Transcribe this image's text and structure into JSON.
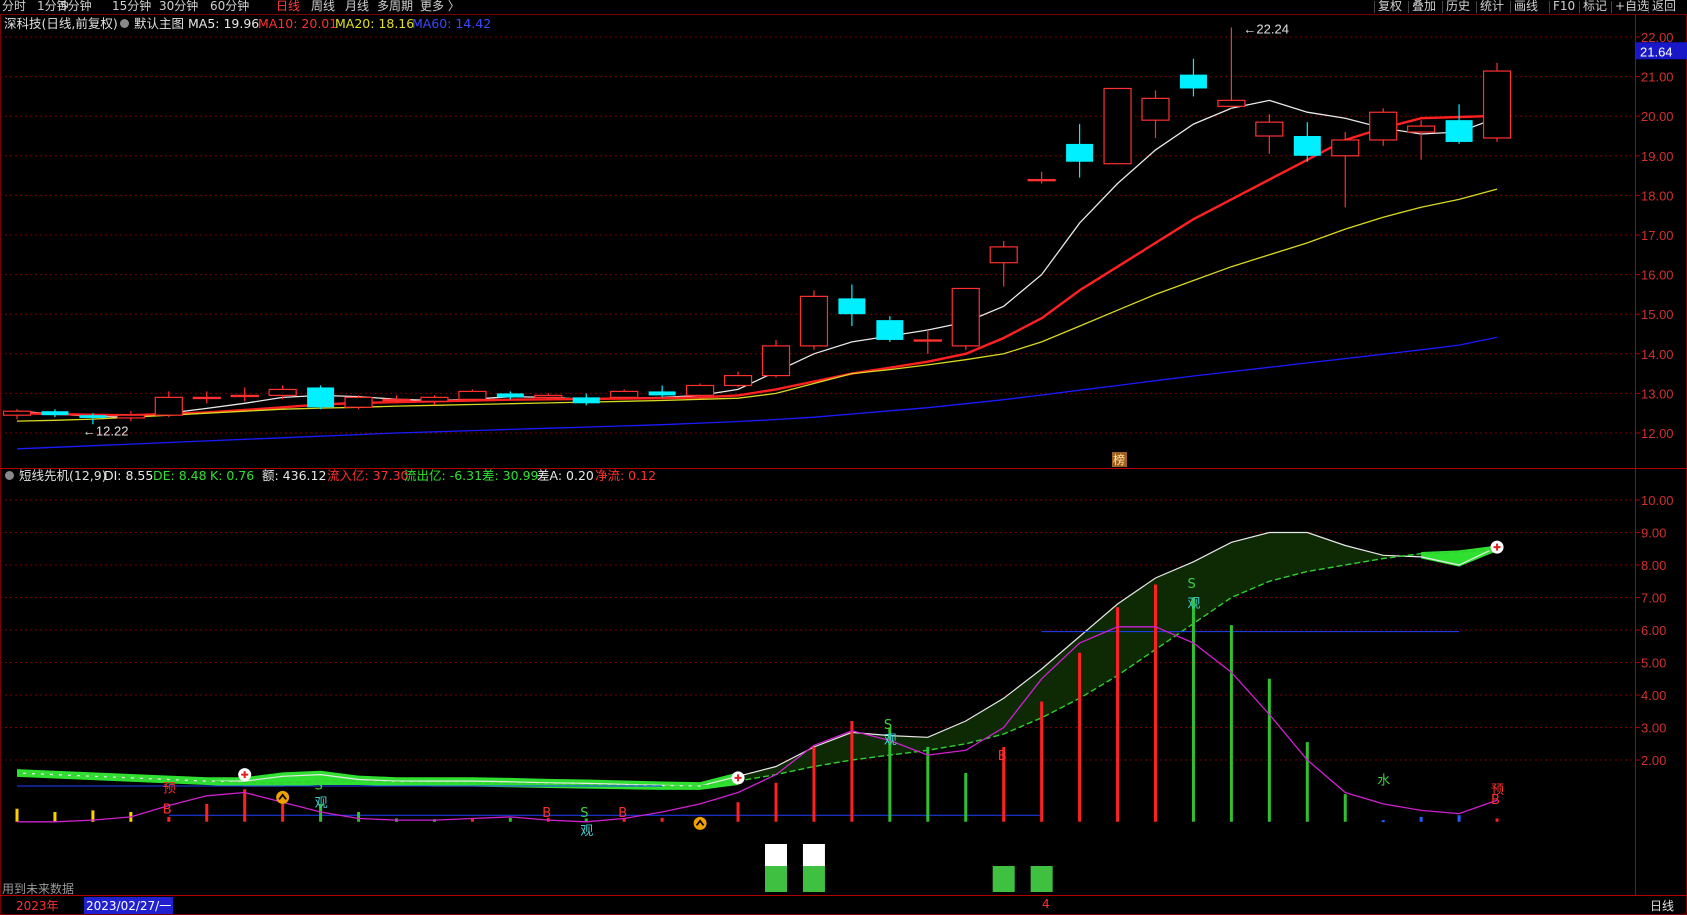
{
  "toolbar": {
    "periods": [
      {
        "label": "分时",
        "active": false
      },
      {
        "label": "1分钟",
        "active": false
      },
      {
        "label": "5分钟",
        "active": false
      },
      {
        "label": "15分钟",
        "active": false
      },
      {
        "label": "30分钟",
        "active": false
      },
      {
        "label": "60分钟",
        "active": false
      },
      {
        "label": "日线",
        "active": true
      },
      {
        "label": "周线",
        "active": false
      },
      {
        "label": "月线",
        "active": false
      },
      {
        "label": "多周期",
        "active": false
      },
      {
        "label": "更多 〉",
        "active": false
      }
    ],
    "right_buttons": [
      "复权",
      "叠加",
      "历史",
      "统计",
      "画线",
      "F10",
      "标记",
      "+自选",
      "返回"
    ]
  },
  "main_header": {
    "title": "深科技(日线,前复权)",
    "template": "默认主图",
    "ma5": "MA5: 19.96",
    "ma10": "MA10: 20.01",
    "ma20": "MA20: 18.16",
    "ma60": "MA60: 14.42"
  },
  "sub_header": {
    "title": "短线先机(12,9)",
    "di": "DI: 8.55",
    "de": "DE: 8.48",
    "k": "K: 0.76",
    "amount": "额: 436.12",
    "inflow": "流入亿: 37.30",
    "outflow": "流出亿: -6.31",
    "diff": "差: 30.99",
    "diff_a": "差A: 0.20",
    "net": "净流: 0.12"
  },
  "bottom": {
    "future_note": "用到未来数据",
    "year": "2023年",
    "cursor_date": "2023/02/27/一",
    "month_marker": "4",
    "period_label": "日线"
  },
  "colors": {
    "up": "#ff3030",
    "down": "#00f0ff",
    "ma5": "#e8e8e8",
    "ma10": "#ff2020",
    "ma20": "#d8d820",
    "ma60": "#1a1aff",
    "grid": "#7a0000"
  },
  "chart_data": [
    {
      "type": "candlestick",
      "price_axis": {
        "ylim": [
          11.6,
          22.6
        ],
        "ticks": [
          "12.00",
          "13.00",
          "14.00",
          "15.00",
          "16.00",
          "17.00",
          "18.00",
          "19.00",
          "20.00",
          "21.00",
          "22.00"
        ],
        "current_price": "21.64"
      },
      "annotations": {
        "high_label": "22.24",
        "low_label": "12.22",
        "badge": "榜"
      },
      "candles": [
        {
          "o": 12.45,
          "c": 12.55,
          "h": 12.6,
          "l": 12.35
        },
        {
          "o": 12.55,
          "c": 12.45,
          "h": 12.6,
          "l": 12.4
        },
        {
          "o": 12.45,
          "c": 12.38,
          "h": 12.5,
          "l": 12.22
        },
        {
          "o": 12.38,
          "c": 12.45,
          "h": 12.55,
          "l": 12.3
        },
        {
          "o": 12.45,
          "c": 12.9,
          "h": 13.05,
          "l": 12.4
        },
        {
          "o": 12.9,
          "c": 12.9,
          "h": 13.05,
          "l": 12.75
        },
        {
          "o": 12.95,
          "c": 12.95,
          "h": 13.15,
          "l": 12.8
        },
        {
          "o": 12.95,
          "c": 13.1,
          "h": 13.2,
          "l": 12.85
        },
        {
          "o": 13.15,
          "c": 12.65,
          "h": 13.2,
          "l": 12.6
        },
        {
          "o": 12.65,
          "c": 12.9,
          "h": 12.95,
          "l": 12.6
        },
        {
          "o": 12.85,
          "c": 12.85,
          "h": 12.95,
          "l": 12.75
        },
        {
          "o": 12.8,
          "c": 12.9,
          "h": 12.95,
          "l": 12.7
        },
        {
          "o": 12.85,
          "c": 13.05,
          "h": 13.1,
          "l": 12.8
        },
        {
          "o": 13.0,
          "c": 12.9,
          "h": 13.05,
          "l": 12.85
        },
        {
          "o": 12.9,
          "c": 12.95,
          "h": 13.0,
          "l": 12.85
        },
        {
          "o": 12.9,
          "c": 12.75,
          "h": 13.0,
          "l": 12.7
        },
        {
          "o": 12.9,
          "c": 13.05,
          "h": 13.1,
          "l": 12.85
        },
        {
          "o": 13.05,
          "c": 12.95,
          "h": 13.2,
          "l": 12.9
        },
        {
          "o": 12.95,
          "c": 13.2,
          "h": 13.25,
          "l": 12.9
        },
        {
          "o": 13.2,
          "c": 13.45,
          "h": 13.55,
          "l": 13.15
        },
        {
          "o": 13.45,
          "c": 14.2,
          "h": 14.35,
          "l": 13.4
        },
        {
          "o": 14.2,
          "c": 15.45,
          "h": 15.6,
          "l": 14.1
        },
        {
          "o": 15.4,
          "c": 15.0,
          "h": 15.75,
          "l": 14.7
        },
        {
          "o": 14.85,
          "c": 14.35,
          "h": 14.95,
          "l": 14.3
        },
        {
          "o": 14.35,
          "c": 14.35,
          "h": 14.6,
          "l": 14.0
        },
        {
          "o": 14.2,
          "c": 15.65,
          "h": 15.65,
          "l": 14.1
        },
        {
          "o": 16.3,
          "c": 16.7,
          "h": 16.85,
          "l": 15.7
        },
        {
          "o": 18.4,
          "c": 18.4,
          "h": 18.6,
          "l": 18.3
        },
        {
          "o": 19.3,
          "c": 18.85,
          "h": 19.8,
          "l": 18.45
        },
        {
          "o": 18.8,
          "c": 20.7,
          "h": 20.7,
          "l": 18.8
        },
        {
          "o": 19.9,
          "c": 20.45,
          "h": 20.65,
          "l": 19.45
        },
        {
          "o": 21.05,
          "c": 20.7,
          "h": 21.45,
          "l": 20.5
        },
        {
          "o": 20.25,
          "c": 20.4,
          "h": 22.24,
          "l": 20.2
        },
        {
          "o": 19.5,
          "c": 19.85,
          "h": 20.05,
          "l": 19.05
        },
        {
          "o": 19.5,
          "c": 19.0,
          "h": 19.85,
          "l": 18.85
        },
        {
          "o": 19.0,
          "c": 19.4,
          "h": 19.6,
          "l": 17.7
        },
        {
          "o": 19.4,
          "c": 20.1,
          "h": 20.2,
          "l": 19.25
        },
        {
          "o": 19.6,
          "c": 19.75,
          "h": 19.9,
          "l": 18.9
        },
        {
          "o": 19.9,
          "c": 19.35,
          "h": 20.3,
          "l": 19.3
        },
        {
          "o": 19.45,
          "c": 21.14,
          "h": 21.35,
          "l": 19.35
        }
      ],
      "series": [
        {
          "name": "MA5",
          "values": [
            12.55,
            12.48,
            12.42,
            12.4,
            12.5,
            12.62,
            12.75,
            12.9,
            12.95,
            12.92,
            12.85,
            12.82,
            12.85,
            12.92,
            12.9,
            12.85,
            12.88,
            12.9,
            12.95,
            13.1,
            13.55,
            14.0,
            14.3,
            14.45,
            14.6,
            14.8,
            15.2,
            16.0,
            17.3,
            18.3,
            19.15,
            19.8,
            20.2,
            20.4,
            20.1,
            19.95,
            19.7,
            19.55,
            19.6,
            19.96
          ]
        },
        {
          "name": "MA10",
          "values": [
            12.5,
            12.48,
            12.46,
            12.45,
            12.48,
            12.52,
            12.58,
            12.65,
            12.72,
            12.76,
            12.78,
            12.8,
            12.82,
            12.84,
            12.85,
            12.86,
            12.87,
            12.88,
            12.9,
            12.95,
            13.1,
            13.3,
            13.5,
            13.65,
            13.8,
            14.0,
            14.4,
            14.9,
            15.6,
            16.2,
            16.8,
            17.4,
            17.9,
            18.4,
            18.9,
            19.4,
            19.7,
            19.95,
            19.98,
            20.01
          ]
        },
        {
          "name": "MA20",
          "values": [
            12.3,
            12.32,
            12.35,
            12.4,
            12.45,
            12.5,
            12.55,
            12.6,
            12.63,
            12.65,
            12.68,
            12.7,
            12.72,
            12.74,
            12.76,
            12.78,
            12.8,
            12.82,
            12.85,
            12.88,
            13.0,
            13.25,
            13.5,
            13.6,
            13.72,
            13.85,
            14.0,
            14.3,
            14.7,
            15.1,
            15.5,
            15.85,
            16.2,
            16.5,
            16.8,
            17.15,
            17.45,
            17.7,
            17.9,
            18.16
          ]
        },
        {
          "name": "MA60",
          "values": [
            11.6,
            11.64,
            11.68,
            11.72,
            11.76,
            11.8,
            11.84,
            11.88,
            11.92,
            11.96,
            12.0,
            12.03,
            12.06,
            12.09,
            12.12,
            12.15,
            12.18,
            12.21,
            12.25,
            12.29,
            12.34,
            12.4,
            12.48,
            12.56,
            12.64,
            12.74,
            12.84,
            12.96,
            13.08,
            13.2,
            13.32,
            13.44,
            13.55,
            13.66,
            13.77,
            13.88,
            13.99,
            14.1,
            14.22,
            14.42
          ]
        }
      ]
    },
    {
      "type": "indicator",
      "axis": {
        "ylim": [
          -0.2,
          10.7
        ],
        "ticks": [
          "2.00",
          "3.00",
          "4.00",
          "5.00",
          "6.00",
          "7.00",
          "8.00",
          "9.00",
          "10.00"
        ]
      },
      "series": [
        {
          "name": "DI",
          "values": [
            1.6,
            1.55,
            1.5,
            1.45,
            1.4,
            1.35,
            1.35,
            1.5,
            1.55,
            1.4,
            1.35,
            1.35,
            1.35,
            1.33,
            1.3,
            1.28,
            1.25,
            1.22,
            1.2,
            1.5,
            1.8,
            2.4,
            2.85,
            2.75,
            2.7,
            3.2,
            3.9,
            4.8,
            5.8,
            6.8,
            7.6,
            8.1,
            8.7,
            9.0,
            9.0,
            8.6,
            8.3,
            8.25,
            8.0,
            8.55
          ]
        },
        {
          "name": "DE",
          "values": [
            1.6,
            1.55,
            1.5,
            1.45,
            1.4,
            1.35,
            1.3,
            1.3,
            1.35,
            1.35,
            1.32,
            1.3,
            1.3,
            1.28,
            1.26,
            1.24,
            1.22,
            1.2,
            1.2,
            1.35,
            1.55,
            1.8,
            2.0,
            2.15,
            2.3,
            2.5,
            2.8,
            3.3,
            3.9,
            4.6,
            5.4,
            6.2,
            7.0,
            7.5,
            7.8,
            8.0,
            8.2,
            8.35,
            8.4,
            8.48
          ]
        },
        {
          "name": "K",
          "values": [
            0.1,
            0.1,
            0.15,
            0.25,
            0.6,
            0.9,
            1.0,
            0.7,
            0.4,
            0.2,
            0.15,
            0.15,
            0.2,
            0.25,
            0.15,
            0.1,
            0.2,
            0.4,
            0.65,
            1.0,
            1.55,
            2.45,
            2.9,
            2.6,
            2.15,
            2.3,
            3.0,
            4.5,
            5.6,
            6.1,
            6.1,
            5.6,
            4.7,
            3.4,
            2.0,
            1.0,
            0.65,
            0.45,
            0.35,
            0.76
          ]
        }
      ],
      "threshold_lines": [
        {
          "y": 1.2,
          "from": 0,
          "to": 17
        },
        {
          "y": 0.3,
          "from": 4,
          "to": 27
        },
        {
          "y": 5.95,
          "from": 27,
          "to": 38
        }
      ],
      "volume_bars": [
        {
          "v": 0.4,
          "c": "#ffd000"
        },
        {
          "v": 0.3,
          "c": "#ffd000"
        },
        {
          "v": 0.35,
          "c": "#ffd000"
        },
        {
          "v": 0.3,
          "c": "#ffd000"
        },
        {
          "v": 0.15,
          "c": "#ff2020"
        },
        {
          "v": 0.55,
          "c": "#ff2020"
        },
        {
          "v": 1.0,
          "c": "#ff2020"
        },
        {
          "v": 0.85,
          "c": "#ff2020"
        },
        {
          "v": 0.55,
          "c": "#30c030"
        },
        {
          "v": 0.3,
          "c": "#30c030"
        },
        {
          "v": 0.1,
          "c": "#30c030"
        },
        {
          "v": 0.08,
          "c": "#30c030"
        },
        {
          "v": 0.1,
          "c": "#ff2020"
        },
        {
          "v": 0.12,
          "c": "#30c030"
        },
        {
          "v": 0.12,
          "c": "#ff2020"
        },
        {
          "v": 0.1,
          "c": "#30c030"
        },
        {
          "v": 0.1,
          "c": "#ff2020"
        },
        {
          "v": 0.12,
          "c": "#ff2020"
        },
        {
          "v": 0.15,
          "c": "#ff2020"
        },
        {
          "v": 0.6,
          "c": "#ff2020"
        },
        {
          "v": 1.2,
          "c": "#ff2020"
        },
        {
          "v": 2.3,
          "c": "#ff2020"
        },
        {
          "v": 3.1,
          "c": "#ff2020"
        },
        {
          "v": 2.9,
          "c": "#30c030"
        },
        {
          "v": 2.3,
          "c": "#30c030"
        },
        {
          "v": 1.5,
          "c": "#30c030"
        },
        {
          "v": 2.3,
          "c": "#ff2020"
        },
        {
          "v": 3.7,
          "c": "#ff2020"
        },
        {
          "v": 5.2,
          "c": "#ff2020"
        },
        {
          "v": 6.6,
          "c": "#ff2020"
        },
        {
          "v": 7.3,
          "c": "#ff2020"
        },
        {
          "v": 6.9,
          "c": "#30c030"
        },
        {
          "v": 6.05,
          "c": "#30c030"
        },
        {
          "v": 4.4,
          "c": "#30c030"
        },
        {
          "v": 2.45,
          "c": "#30c030"
        },
        {
          "v": 0.85,
          "c": "#30c030"
        },
        {
          "v": 0.05,
          "c": "#2060ff"
        },
        {
          "v": 0.15,
          "c": "#2060ff"
        },
        {
          "v": 0.2,
          "c": "#2060ff"
        },
        {
          "v": 0.1,
          "c": "#ff2020"
        }
      ],
      "signals": [
        {
          "i": 4,
          "text": "B",
          "color": "#ff3030",
          "y": 0.35
        },
        {
          "i": 4,
          "text": "预",
          "color": "#ff3030",
          "y": 1.0
        },
        {
          "i": 8,
          "text": "S",
          "color": "#40d040",
          "y": 1.1
        },
        {
          "i": 8,
          "text": "观",
          "color": "#40d0d0",
          "y": 0.55
        },
        {
          "i": 14,
          "text": "B",
          "color": "#ff3030",
          "y": 0.25
        },
        {
          "i": 15,
          "text": "S",
          "color": "#40d040",
          "y": 0.25
        },
        {
          "i": 15,
          "text": "观",
          "color": "#40d0d0",
          "y": -0.3
        },
        {
          "i": 16,
          "text": "B",
          "color": "#ff3030",
          "y": 0.25
        },
        {
          "i": 23,
          "text": "S",
          "color": "#40d040",
          "y": 2.95
        },
        {
          "i": 23,
          "text": "观",
          "color": "#40d0d0",
          "y": 2.5
        },
        {
          "i": 26,
          "text": "B",
          "color": "#ff3030",
          "y": 2.0
        },
        {
          "i": 31,
          "text": "S",
          "color": "#40d040",
          "y": 7.3
        },
        {
          "i": 31,
          "text": "观",
          "color": "#40d0d0",
          "y": 6.7
        },
        {
          "i": 36,
          "text": "水",
          "color": "#40d040",
          "y": 1.25
        },
        {
          "i": 39,
          "text": "预",
          "color": "#ff3030",
          "y": 0.95
        },
        {
          "i": 39,
          "text": "B",
          "color": "#ff3030",
          "y": 0.65
        }
      ],
      "markers": [
        {
          "i": 6,
          "kind": "plus",
          "y": 1.55
        },
        {
          "i": 7,
          "kind": "up",
          "y": 0.85
        },
        {
          "i": 18,
          "kind": "up",
          "y": 0.05
        },
        {
          "i": 19,
          "kind": "plus",
          "y": 1.45
        },
        {
          "i": 39,
          "kind": "plus",
          "y": 8.55
        }
      ],
      "bottom_boxes": [
        {
          "i": 20,
          "kind": "split"
        },
        {
          "i": 21,
          "kind": "split"
        },
        {
          "i": 26,
          "kind": "full"
        },
        {
          "i": 27,
          "kind": "full"
        }
      ]
    }
  ]
}
